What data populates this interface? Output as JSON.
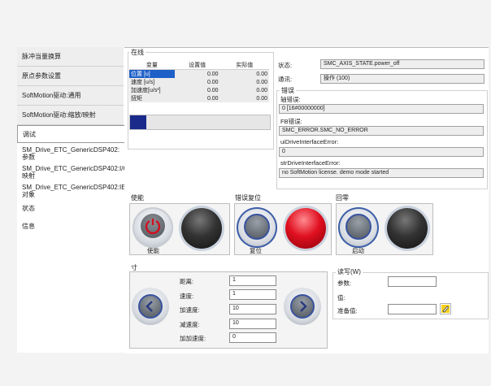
{
  "sidebar": {
    "items": [
      {
        "label": "脉冲当量换算"
      },
      {
        "label": "原点参数设置"
      },
      {
        "label": "SoftMotion驱动:通用"
      },
      {
        "label": "SoftMotion驱动:缩放/映射"
      },
      {
        "label": "调试"
      },
      {
        "label": "SM_Drive_ETC_GenericDSP402:参数"
      },
      {
        "label": "SM_Drive_ETC_GenericDSP402:I/O映射"
      },
      {
        "label": "SM_Drive_ETC_GenericDSP402:IEC对象"
      },
      {
        "label": "状态"
      },
      {
        "label": "信息"
      }
    ]
  },
  "online": {
    "title": "在线",
    "headers": [
      "变量",
      "设置值",
      "实际值"
    ],
    "rows": [
      {
        "name": "位置 [u]",
        "set": "0.00",
        "actual": "0.00"
      },
      {
        "name": "速度 [u/s]",
        "set": "0.00",
        "actual": "0.00"
      },
      {
        "name": "加速度[u/s²]",
        "set": "0.00",
        "actual": "0.00"
      },
      {
        "name": "扭矩",
        "set": "0.00",
        "actual": "0.00"
      }
    ]
  },
  "status": {
    "state_label": "状态:",
    "state_value": "SMC_AXIS_STATE.power_off",
    "comm_label": "通讯:",
    "comm_value": "操作 (100)",
    "error_title": "错误",
    "axis_error_label": "轴错误:",
    "axis_error_value": "0 [16#00000000]",
    "fb_error_label": "FB错误:",
    "fb_error_value": "SMC_ERROR.SMC_NO_ERROR",
    "ui_error_label": "uiDriveInterfaceError:",
    "ui_error_value": "0",
    "str_error_label": "strDriveInterfaceError:",
    "str_error_value": "no SoftMotion license. demo mode started"
  },
  "controls": {
    "enable_title": "使能",
    "enable_button": "使能",
    "reset_title": "错误复位",
    "reset_button": "复位",
    "home_title": "回零",
    "home_button": "启动",
    "colors": {
      "enable_lamp": "#2a2a2a",
      "error_lamp": "#e01020",
      "home_lamp": "#2a2a2a",
      "ring": "#c7cdd6",
      "knob": "#5a6068"
    }
  },
  "jog": {
    "title": "寸",
    "distance_label": "距离:",
    "distance_value": "1",
    "velocity_label": "速度:",
    "velocity_value": "1",
    "accel_label": "加速度:",
    "accel_value": "10",
    "decel_label": "减速度:",
    "decel_value": "10",
    "jerk_label": "加加速度:",
    "jerk_value": "0"
  },
  "rw": {
    "title": "读写(W)",
    "param_label": "参数:",
    "param_value": "",
    "value_label": "值:",
    "ready_label": "准备值:",
    "ready_value": "",
    "edit_icon": "pencil-icon"
  }
}
